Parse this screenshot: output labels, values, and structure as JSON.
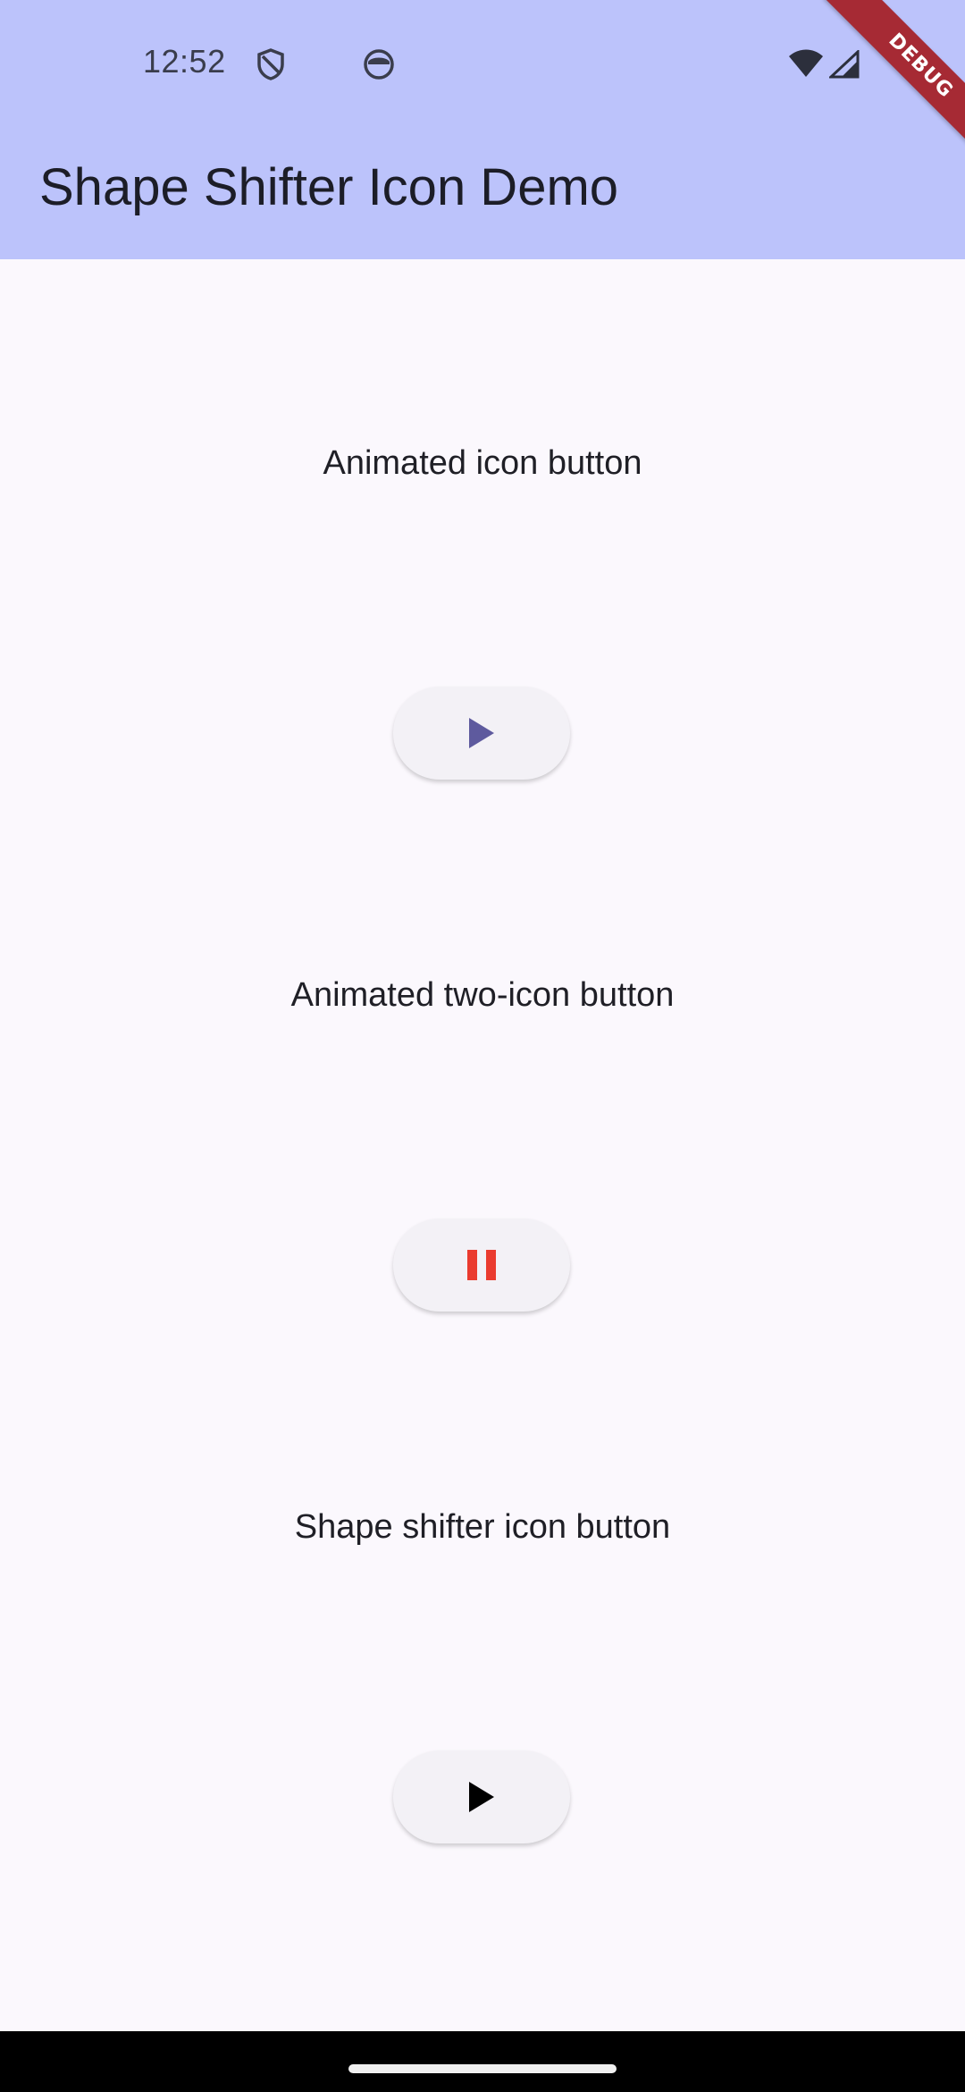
{
  "status_bar": {
    "time": "12:52",
    "icons": [
      "shield-icon",
      "circle-face-icon",
      "wifi-icon",
      "cell-signal-icon"
    ]
  },
  "app_bar": {
    "title": "Shape Shifter Icon Demo",
    "debug_banner": "DEBUG"
  },
  "sections": [
    {
      "label": "Animated icon button",
      "button_icon": "play-icon",
      "icon_color": "#5e5a9e"
    },
    {
      "label": "Animated two-icon button",
      "button_icon": "pause-icon",
      "icon_color": "#ea3b2f"
    },
    {
      "label": "Shape shifter icon button",
      "button_icon": "play-icon",
      "icon_color": "#000000"
    }
  ],
  "colors": {
    "app_bar_bg": "#bcc3fb",
    "page_bg": "#fbf8fd",
    "button_bg": "#f3f1f6",
    "debug_ribbon": "#a62a34"
  }
}
